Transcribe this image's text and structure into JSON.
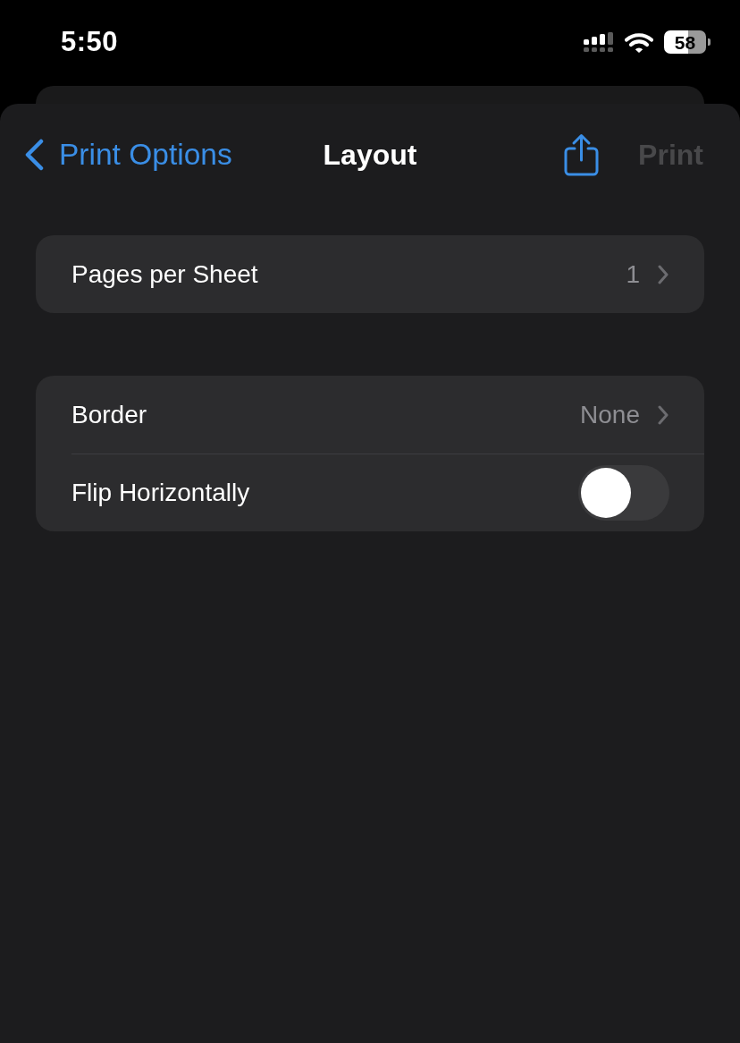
{
  "status_bar": {
    "time": "5:50",
    "battery": "58"
  },
  "nav_bar": {
    "back": "Print Options",
    "title": "Layout",
    "action": "Print",
    "action_disabled": true
  },
  "sections": [
    {
      "rows": [
        {
          "kind": "value",
          "label": "Pages per Sheet",
          "value": "1"
        }
      ]
    },
    {
      "rows": [
        {
          "kind": "value",
          "label": "Border",
          "value": "None"
        },
        {
          "kind": "toggle",
          "label": "Flip Horizontally",
          "on": false
        }
      ]
    }
  ]
}
